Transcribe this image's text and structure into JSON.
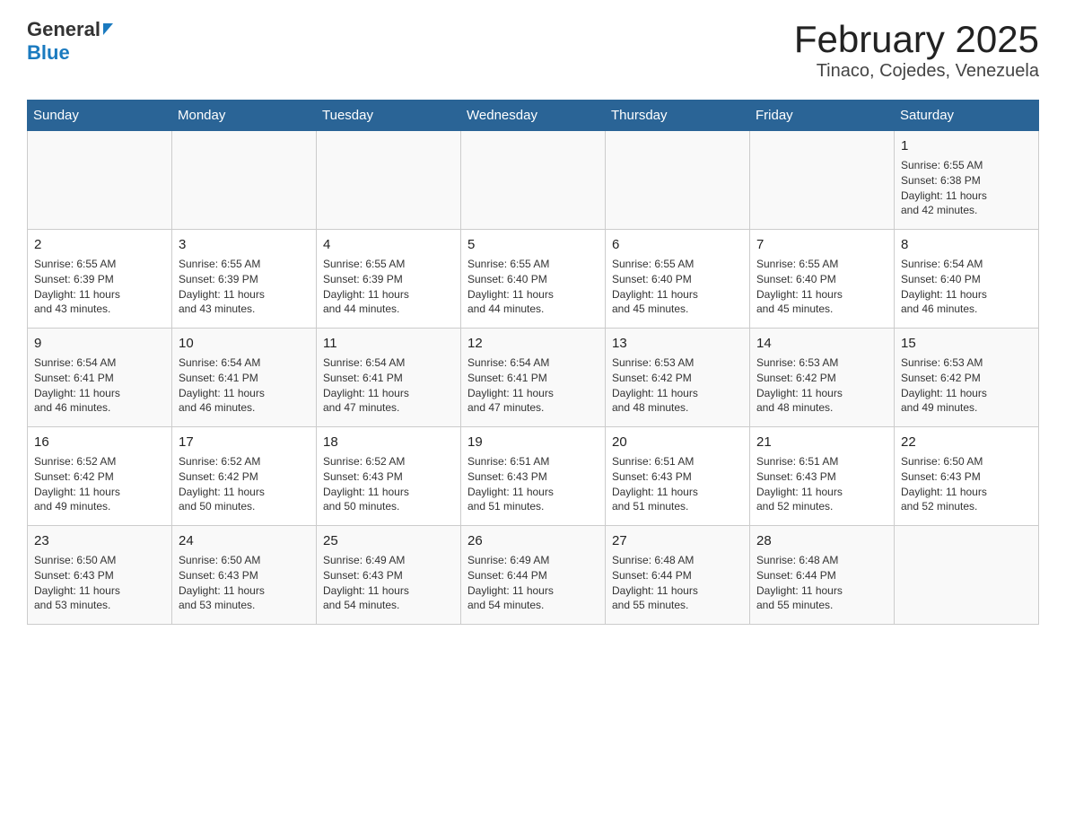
{
  "header": {
    "logo_general": "General",
    "logo_blue": "Blue",
    "month_title": "February 2025",
    "location": "Tinaco, Cojedes, Venezuela"
  },
  "weekdays": [
    "Sunday",
    "Monday",
    "Tuesday",
    "Wednesday",
    "Thursday",
    "Friday",
    "Saturday"
  ],
  "weeks": [
    [
      {
        "day": "",
        "info": ""
      },
      {
        "day": "",
        "info": ""
      },
      {
        "day": "",
        "info": ""
      },
      {
        "day": "",
        "info": ""
      },
      {
        "day": "",
        "info": ""
      },
      {
        "day": "",
        "info": ""
      },
      {
        "day": "1",
        "info": "Sunrise: 6:55 AM\nSunset: 6:38 PM\nDaylight: 11 hours\nand 42 minutes."
      }
    ],
    [
      {
        "day": "2",
        "info": "Sunrise: 6:55 AM\nSunset: 6:39 PM\nDaylight: 11 hours\nand 43 minutes."
      },
      {
        "day": "3",
        "info": "Sunrise: 6:55 AM\nSunset: 6:39 PM\nDaylight: 11 hours\nand 43 minutes."
      },
      {
        "day": "4",
        "info": "Sunrise: 6:55 AM\nSunset: 6:39 PM\nDaylight: 11 hours\nand 44 minutes."
      },
      {
        "day": "5",
        "info": "Sunrise: 6:55 AM\nSunset: 6:40 PM\nDaylight: 11 hours\nand 44 minutes."
      },
      {
        "day": "6",
        "info": "Sunrise: 6:55 AM\nSunset: 6:40 PM\nDaylight: 11 hours\nand 45 minutes."
      },
      {
        "day": "7",
        "info": "Sunrise: 6:55 AM\nSunset: 6:40 PM\nDaylight: 11 hours\nand 45 minutes."
      },
      {
        "day": "8",
        "info": "Sunrise: 6:54 AM\nSunset: 6:40 PM\nDaylight: 11 hours\nand 46 minutes."
      }
    ],
    [
      {
        "day": "9",
        "info": "Sunrise: 6:54 AM\nSunset: 6:41 PM\nDaylight: 11 hours\nand 46 minutes."
      },
      {
        "day": "10",
        "info": "Sunrise: 6:54 AM\nSunset: 6:41 PM\nDaylight: 11 hours\nand 46 minutes."
      },
      {
        "day": "11",
        "info": "Sunrise: 6:54 AM\nSunset: 6:41 PM\nDaylight: 11 hours\nand 47 minutes."
      },
      {
        "day": "12",
        "info": "Sunrise: 6:54 AM\nSunset: 6:41 PM\nDaylight: 11 hours\nand 47 minutes."
      },
      {
        "day": "13",
        "info": "Sunrise: 6:53 AM\nSunset: 6:42 PM\nDaylight: 11 hours\nand 48 minutes."
      },
      {
        "day": "14",
        "info": "Sunrise: 6:53 AM\nSunset: 6:42 PM\nDaylight: 11 hours\nand 48 minutes."
      },
      {
        "day": "15",
        "info": "Sunrise: 6:53 AM\nSunset: 6:42 PM\nDaylight: 11 hours\nand 49 minutes."
      }
    ],
    [
      {
        "day": "16",
        "info": "Sunrise: 6:52 AM\nSunset: 6:42 PM\nDaylight: 11 hours\nand 49 minutes."
      },
      {
        "day": "17",
        "info": "Sunrise: 6:52 AM\nSunset: 6:42 PM\nDaylight: 11 hours\nand 50 minutes."
      },
      {
        "day": "18",
        "info": "Sunrise: 6:52 AM\nSunset: 6:43 PM\nDaylight: 11 hours\nand 50 minutes."
      },
      {
        "day": "19",
        "info": "Sunrise: 6:51 AM\nSunset: 6:43 PM\nDaylight: 11 hours\nand 51 minutes."
      },
      {
        "day": "20",
        "info": "Sunrise: 6:51 AM\nSunset: 6:43 PM\nDaylight: 11 hours\nand 51 minutes."
      },
      {
        "day": "21",
        "info": "Sunrise: 6:51 AM\nSunset: 6:43 PM\nDaylight: 11 hours\nand 52 minutes."
      },
      {
        "day": "22",
        "info": "Sunrise: 6:50 AM\nSunset: 6:43 PM\nDaylight: 11 hours\nand 52 minutes."
      }
    ],
    [
      {
        "day": "23",
        "info": "Sunrise: 6:50 AM\nSunset: 6:43 PM\nDaylight: 11 hours\nand 53 minutes."
      },
      {
        "day": "24",
        "info": "Sunrise: 6:50 AM\nSunset: 6:43 PM\nDaylight: 11 hours\nand 53 minutes."
      },
      {
        "day": "25",
        "info": "Sunrise: 6:49 AM\nSunset: 6:43 PM\nDaylight: 11 hours\nand 54 minutes."
      },
      {
        "day": "26",
        "info": "Sunrise: 6:49 AM\nSunset: 6:44 PM\nDaylight: 11 hours\nand 54 minutes."
      },
      {
        "day": "27",
        "info": "Sunrise: 6:48 AM\nSunset: 6:44 PM\nDaylight: 11 hours\nand 55 minutes."
      },
      {
        "day": "28",
        "info": "Sunrise: 6:48 AM\nSunset: 6:44 PM\nDaylight: 11 hours\nand 55 minutes."
      },
      {
        "day": "",
        "info": ""
      }
    ]
  ]
}
